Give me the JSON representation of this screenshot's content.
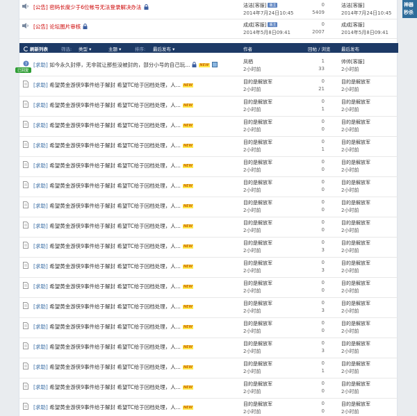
{
  "announcements": [
    {
      "tag": "[公告]",
      "title": "密码长度少于6位帐号无法登录解决办法",
      "author": "洁洁[客服]",
      "author_badge": "版主",
      "date": "2014年7月24日10:45",
      "replies": "0",
      "views": "5409",
      "last_author": "洁洁[客服]",
      "last_time": "2014年7月24日10:45"
    },
    {
      "tag": "[公告]",
      "title": "论坛图片审核",
      "author": "成成[客服]",
      "author_badge": "版主",
      "date": "2014年5月8日09:41",
      "replies": "0",
      "views": "2007",
      "last_author": "成成[客服]",
      "last_time": "2014年5月8日09:41"
    }
  ],
  "toolbar": {
    "refresh": "刷新列表",
    "filter_label": "筛选:",
    "type": "类型",
    "topic": "主题",
    "sort_label": "排序:",
    "latest": "最后发布",
    "col_author": "作者",
    "col_stats": "回帖 / 浏览",
    "col_last": "最后发布"
  },
  "threads": [
    {
      "cat": "[求助]",
      "title": "如今永久封停，无非就让那些没被封的，部分小号的自己玩...",
      "author": "凤栖",
      "time": "2小时前",
      "replies": "1",
      "views": "33",
      "last_author": "帅帅[客服]",
      "last_time": "2小时前",
      "stamp": "已回复",
      "icon": "question",
      "extra": true
    },
    {
      "cat": "[求助]",
      "title": "希望黄金游侠9事件给于解封 希望TC给于回档处理，人...",
      "author": "目的是解放军",
      "time": "2小时前",
      "replies": "0",
      "views": "21",
      "last_author": "目的是解放军",
      "last_time": "2小时前"
    },
    {
      "cat": "[求助]",
      "title": "希望黄金游侠9事件给于解封 希望TC给于回档处理，人...",
      "author": "目的是解放军",
      "time": "2小时前",
      "replies": "0",
      "views": "1",
      "last_author": "目的是解放军",
      "last_time": "2小时前"
    },
    {
      "cat": "[求助]",
      "title": "希望黄金游侠9事件给于解封 希望TC给于回档处理，人...",
      "author": "目的是解放军",
      "time": "2小时前",
      "replies": "0",
      "views": "0",
      "last_author": "目的是解放军",
      "last_time": "2小时前"
    },
    {
      "cat": "[求助]",
      "title": "希望黄金游侠9事件给于解封 希望TC给于回档处理，人...",
      "author": "目的是解放军",
      "time": "2小时前",
      "replies": "0",
      "views": "1",
      "last_author": "目的是解放军",
      "last_time": "2小时前"
    },
    {
      "cat": "[求助]",
      "title": "希望黄金游侠9事件给于解封 希望TC给于回档处理，人...",
      "author": "目的是解放军",
      "time": "2小时前",
      "replies": "0",
      "views": "0",
      "last_author": "目的是解放军",
      "last_time": "2小时前"
    },
    {
      "cat": "[求助]",
      "title": "希望黄金游侠9事件给于解封 希望TC给于回档处理，人...",
      "author": "目的是解放军",
      "time": "2小时前",
      "replies": "0",
      "views": "0",
      "last_author": "目的是解放军",
      "last_time": "2小时前"
    },
    {
      "cat": "[求助]",
      "title": "希望黄金游侠9事件给于解封 希望TC给于回档处理，人...",
      "author": "目的是解放军",
      "time": "2小时前",
      "replies": "0",
      "views": "0",
      "last_author": "目的是解放军",
      "last_time": "2小时前"
    },
    {
      "cat": "[求助]",
      "title": "希望黄金游侠9事件给于解封 希望TC给于回档处理，人...",
      "author": "目的是解放军",
      "time": "2小时前",
      "replies": "0",
      "views": "0",
      "last_author": "目的是解放军",
      "last_time": "2小时前"
    },
    {
      "cat": "[求助]",
      "title": "希望黄金游侠9事件给于解封 希望TC给于回档处理，人...",
      "author": "目的是解放军",
      "time": "2小时前",
      "replies": "0",
      "views": "3",
      "last_author": "目的是解放军",
      "last_time": "2小时前"
    },
    {
      "cat": "[求助]",
      "title": "希望黄金游侠9事件给于解封 希望TC给于回档处理，人...",
      "author": "目的是解放军",
      "time": "2小时前",
      "replies": "0",
      "views": "3",
      "last_author": "目的是解放军",
      "last_time": "2小时前"
    },
    {
      "cat": "[求助]",
      "title": "希望黄金游侠9事件给于解封 希望TC给于回档处理，人...",
      "author": "目的是解放军",
      "time": "2小时前",
      "replies": "0",
      "views": "0",
      "last_author": "目的是解放军",
      "last_time": "2小时前"
    },
    {
      "cat": "[求助]",
      "title": "希望黄金游侠9事件给于解封 希望TC给于回档处理，人...",
      "author": "目的是解放军",
      "time": "2小时前",
      "replies": "0",
      "views": "3",
      "last_author": "目的是解放军",
      "last_time": "2小时前"
    },
    {
      "cat": "[求助]",
      "title": "希望黄金游侠9事件给于解封 希望TC给于回档处理，人...",
      "author": "目的是解放军",
      "time": "2小时前",
      "replies": "0",
      "views": "0",
      "last_author": "目的是解放军",
      "last_time": "2小时前"
    },
    {
      "cat": "[求助]",
      "title": "希望黄金游侠9事件给于解封 希望TC给于回档处理，人...",
      "author": "目的是解放军",
      "time": "2小时前",
      "replies": "0",
      "views": "3",
      "last_author": "目的是解放军",
      "last_time": "2小时前"
    },
    {
      "cat": "[求助]",
      "title": "希望黄金游侠9事件给于解封 希望TC给于回档处理，人...",
      "author": "目的是解放军",
      "time": "2小时前",
      "replies": "0",
      "views": "1",
      "last_author": "目的是解放军",
      "last_time": "2小时前"
    },
    {
      "cat": "[求助]",
      "title": "希望黄金游侠9事件给于解封 希望TC给于回档处理，人...",
      "author": "目的是解放军",
      "time": "2小时前",
      "replies": "0",
      "views": "0",
      "last_author": "目的是解放军",
      "last_time": "2小时前"
    },
    {
      "cat": "[求助]",
      "title": "希望黄金游侠9事件给于解封 希望TC给于回档处理，人...",
      "author": "目的是解放军",
      "time": "2小时前",
      "replies": "0",
      "views": "0",
      "last_author": "目的是解放军",
      "last_time": "2小时前"
    }
  ],
  "new_badge": "NEW",
  "side_box": {
    "line1": "神器",
    "line2": "秒杀"
  }
}
